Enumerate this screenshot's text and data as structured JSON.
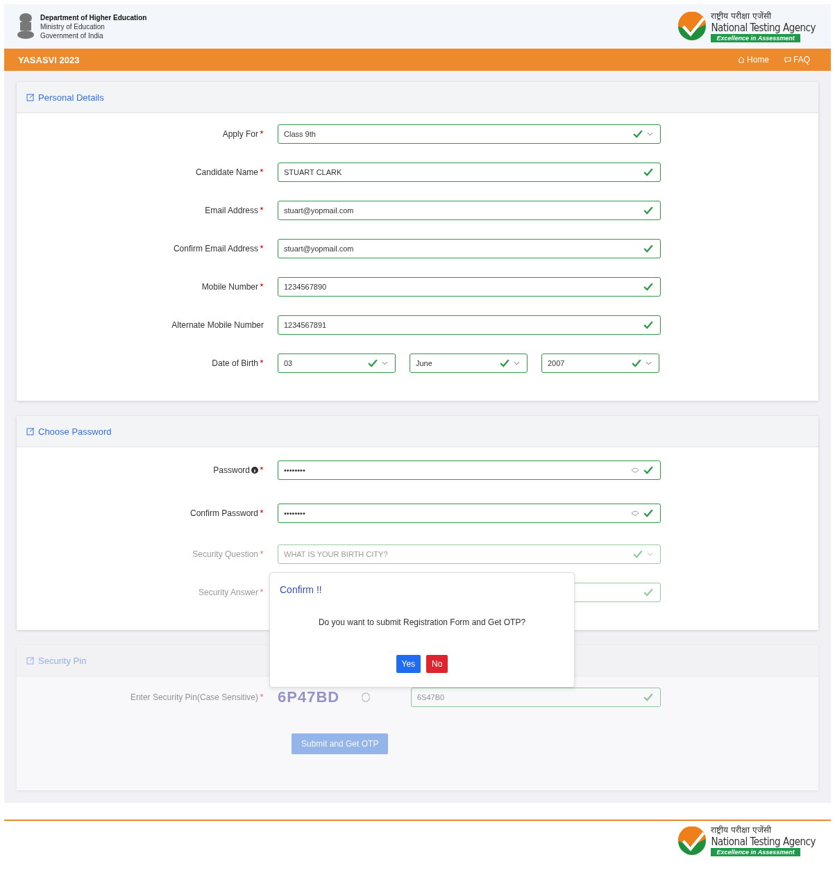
{
  "header": {
    "dept": [
      "Department of Higher Education",
      "Ministry of Education",
      "Government of India"
    ],
    "logo": {
      "hindi": "राष्ट्रीय परीक्षा एजेंसी",
      "name": "National Testing Agency",
      "tagline": "Excellence in Assessment"
    }
  },
  "navbar": {
    "title": "YASASVI 2023",
    "links": [
      {
        "label": "Home"
      },
      {
        "label": "FAQ"
      }
    ]
  },
  "sections": [
    {
      "title": "Personal Details",
      "faded": false,
      "fields": [
        {
          "kind": "select",
          "label": "Apply For",
          "required": true,
          "value": "Class 9th",
          "valid": true
        },
        {
          "kind": "text",
          "label": "Candidate Name",
          "required": true,
          "value": "STUART CLARK",
          "valid": true
        },
        {
          "kind": "text",
          "label": "Email Address",
          "required": true,
          "value": "stuart@yopmail.com",
          "valid": true
        },
        {
          "kind": "text",
          "label": "Confirm Email Address",
          "required": true,
          "value": "stuart@yopmail.com",
          "valid": true
        },
        {
          "kind": "text",
          "label": "Mobile Number",
          "required": true,
          "value": "1234567890",
          "valid": true
        },
        {
          "kind": "text",
          "label": "Alternate Mobile Number",
          "required": false,
          "value": "1234567891",
          "valid": true
        },
        {
          "kind": "date",
          "label": "Date of Birth",
          "required": true,
          "parts": [
            {
              "value": "03",
              "valid": true
            },
            {
              "value": "June",
              "valid": true
            },
            {
              "value": "2007",
              "valid": true
            }
          ]
        }
      ]
    },
    {
      "title": "Choose Password",
      "faded": false,
      "fields": [
        {
          "kind": "password",
          "label": "Password",
          "info": true,
          "required": true,
          "value": "••••••••",
          "valid": true
        },
        {
          "kind": "password",
          "label": "Confirm Password",
          "info": false,
          "required": true,
          "value": "••••••••",
          "valid": true
        },
        {
          "kind": "select",
          "label": "Security Question",
          "required": true,
          "value": "WHAT IS YOUR BIRTH CITY?",
          "valid": true,
          "faded": true
        },
        {
          "kind": "text",
          "label": "Security Answer",
          "required": true,
          "valid": true,
          "faded": true
        }
      ]
    },
    {
      "title": "Security Pin",
      "faded": true,
      "fields": [
        {
          "kind": "captcha",
          "label": "Enter Security Pin(Case Sensitive)",
          "required": true,
          "code": "6P47BD",
          "value": "6S47B0",
          "valid": true
        },
        {
          "kind": "submit",
          "label": "Submit and Get OTP"
        }
      ]
    }
  ],
  "footer": {
    "logo": {
      "hindi": "राष्ट्रीय परीक्षा एजेंसी",
      "name": "National Testing Agency",
      "tagline": "Excellence in Assessment"
    }
  },
  "dialog": {
    "title": "Confirm !!",
    "message": "Do you want to submit Registration Form and Get OTP?",
    "buttons": [
      {
        "kind": "primary",
        "label": "Yes"
      },
      {
        "kind": "danger",
        "label": "No"
      }
    ]
  }
}
